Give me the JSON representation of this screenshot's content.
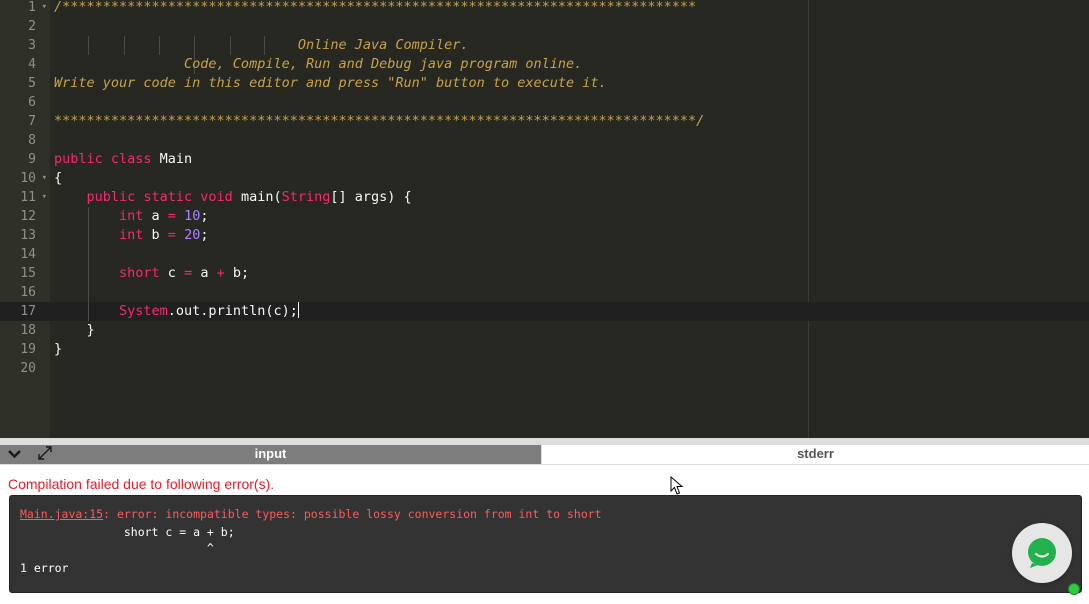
{
  "editor": {
    "line_numbers": [
      "1",
      "2",
      "3",
      "4",
      "5",
      "6",
      "7",
      "8",
      "9",
      "10",
      "11",
      "12",
      "13",
      "14",
      "15",
      "16",
      "17",
      "18",
      "19",
      "20"
    ],
    "fold_markers": {
      "1": "▾",
      "10": "▾",
      "11": "▾"
    },
    "lines": {
      "l1": "/******************************************************************************",
      "l3": "                              Online Java Compiler.",
      "l4": "                Code, Compile, Run and Debug java program online.",
      "l5": "Write your code in this editor and press \"Run\" button to execute it.",
      "l7": "*******************************************************************************/",
      "l9_kw": "public class",
      "l9_name": " Main",
      "l10": "{",
      "l11_kw": "    public static void",
      "l11_a": " main(",
      "l11_type": "String",
      "l11_b": "[] args) {",
      "l12_kw": "        int",
      "l12_a": " a ",
      "l12_op": "=",
      "l12_sp": " ",
      "l12_num": "10",
      "l12_end": ";",
      "l13_kw": "        int",
      "l13_a": " b ",
      "l13_op": "=",
      "l13_sp": " ",
      "l13_num": "20",
      "l13_end": ";",
      "l15_kw": "        short",
      "l15_a": " c ",
      "l15_op1": "=",
      "l15_b": " a ",
      "l15_op2": "+",
      "l15_c": " b;",
      "l17_sys": "        System",
      "l17_rest": ".out.println(c);",
      "l18": "    }",
      "l19": "}"
    }
  },
  "tabs": {
    "input_label": "input",
    "stderr_label": "stderr"
  },
  "icons": {
    "collapse": "chevron-down-icon",
    "expand": "expand-icon",
    "chat": "chat-icon"
  },
  "output": {
    "error_heading": "Compilation failed due to following error(s).",
    "console": {
      "err_location": "Main.java:15",
      "err_message": ": error: incompatible types: possible lossy conversion from int to short",
      "code_line": "               short c = a + b;",
      "caret_line": "                           ^",
      "summary": "1 error"
    }
  },
  "colors": {
    "editor_bg": "#272822",
    "comment": "#c8a24a",
    "keyword": "#f92672",
    "error_red": "#e0202e",
    "chat_green": "#22b14c"
  }
}
